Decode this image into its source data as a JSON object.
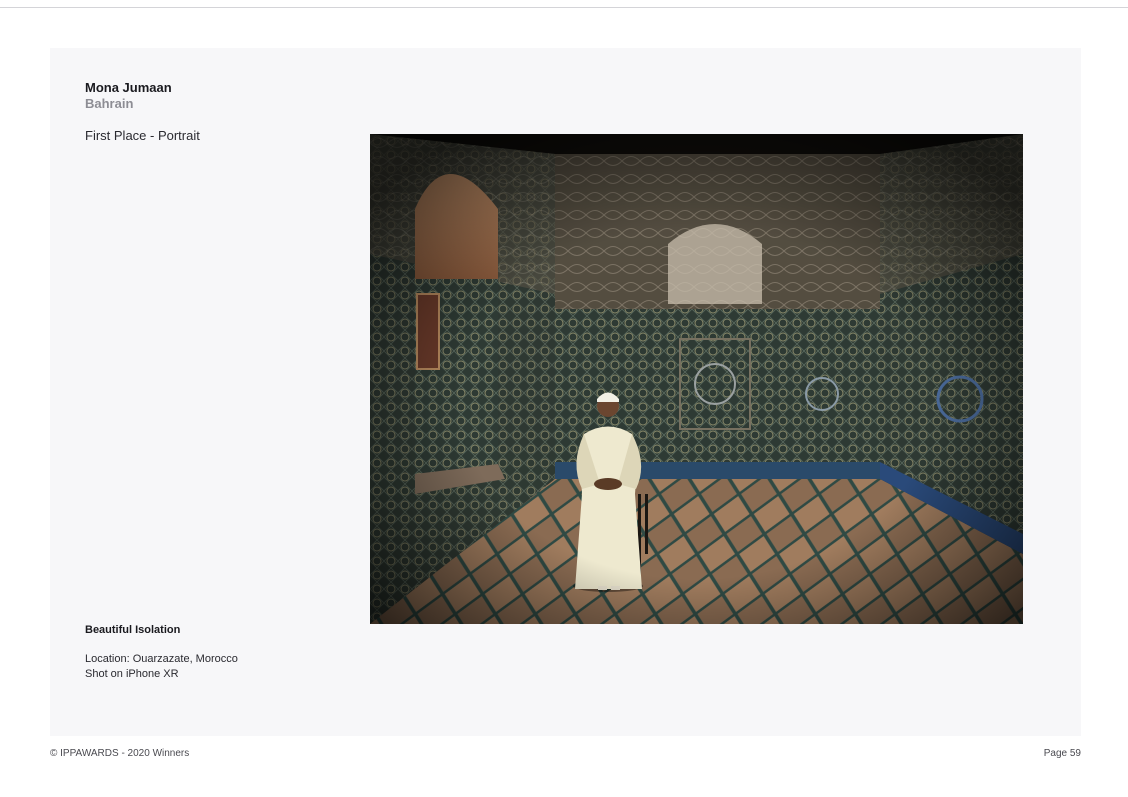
{
  "entry": {
    "photographer": "Mona Jumaan",
    "country": "Bahrain",
    "award": "First Place - Portrait"
  },
  "caption": {
    "title": "Beautiful Isolation",
    "location": "Location:  Ouarzazate, Morocco",
    "device": "Shot on iPhone XR"
  },
  "footer": {
    "copyright": "© IPPAWARDS - 2020 Winners",
    "page": "Page 59"
  }
}
